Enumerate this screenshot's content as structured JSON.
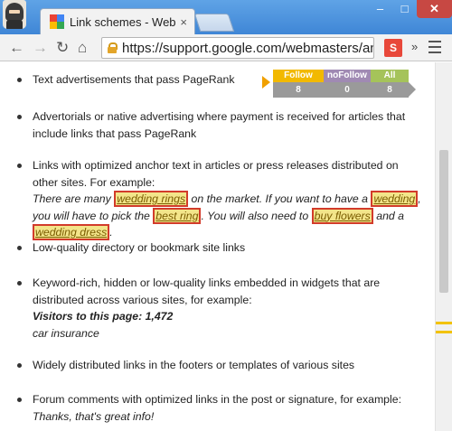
{
  "browser": {
    "tab_title": "Link schemes - Webmaster",
    "tab_close": "×",
    "url": "https://support.google.com/webmasters/answ",
    "window_controls": {
      "minimize": "–",
      "maximize": "□",
      "close": "✕"
    },
    "overflow_label": "»"
  },
  "widget": {
    "columns": [
      {
        "label": "Follow",
        "value": "8",
        "color": "#f2b900"
      },
      {
        "label": "noFollow",
        "value": "0",
        "color": "#a08ab3"
      },
      {
        "label": "All",
        "value": "8",
        "color": "#a5c35a"
      }
    ]
  },
  "content": {
    "item1": "Text advertisements that pass PageRank",
    "item2": "Advertorials or native advertising where payment is received for articles that include links that pass PageRank",
    "item3": {
      "intro": "Links with optimized anchor text in articles or press releases distributed on other sites. For example:",
      "ex_a": "There are many ",
      "kw1": "wedding rings",
      "ex_b": " on the market. If you want to have a ",
      "kw2": "wedding",
      "ex_c": ", you will have to pick the ",
      "kw3": "best ring",
      "ex_d": ". You will also need to ",
      "kw4": "buy flowers",
      "ex_e": " and a ",
      "kw5": "wedding dress",
      "ex_f": "."
    },
    "item4": "Low-quality directory or bookmark site links",
    "item5": {
      "intro": "Keyword-rich, hidden or low-quality links embedded in widgets that are distributed across various sites, for example:",
      "bold": "Visitors to this page: 1,472",
      "italic": "car insurance"
    },
    "item6": "Widely distributed links in the footers or templates of various sites",
    "item7": {
      "intro": "Forum comments with optimized links in the post or signature, for example:",
      "italic": "Thanks, that's great info!"
    }
  },
  "colors": {
    "titlebar": "#4a90e2",
    "keyword_highlight": "#f3e58a",
    "keyword_border": "#d23b2b",
    "scroll_marker": "#f2c200"
  }
}
